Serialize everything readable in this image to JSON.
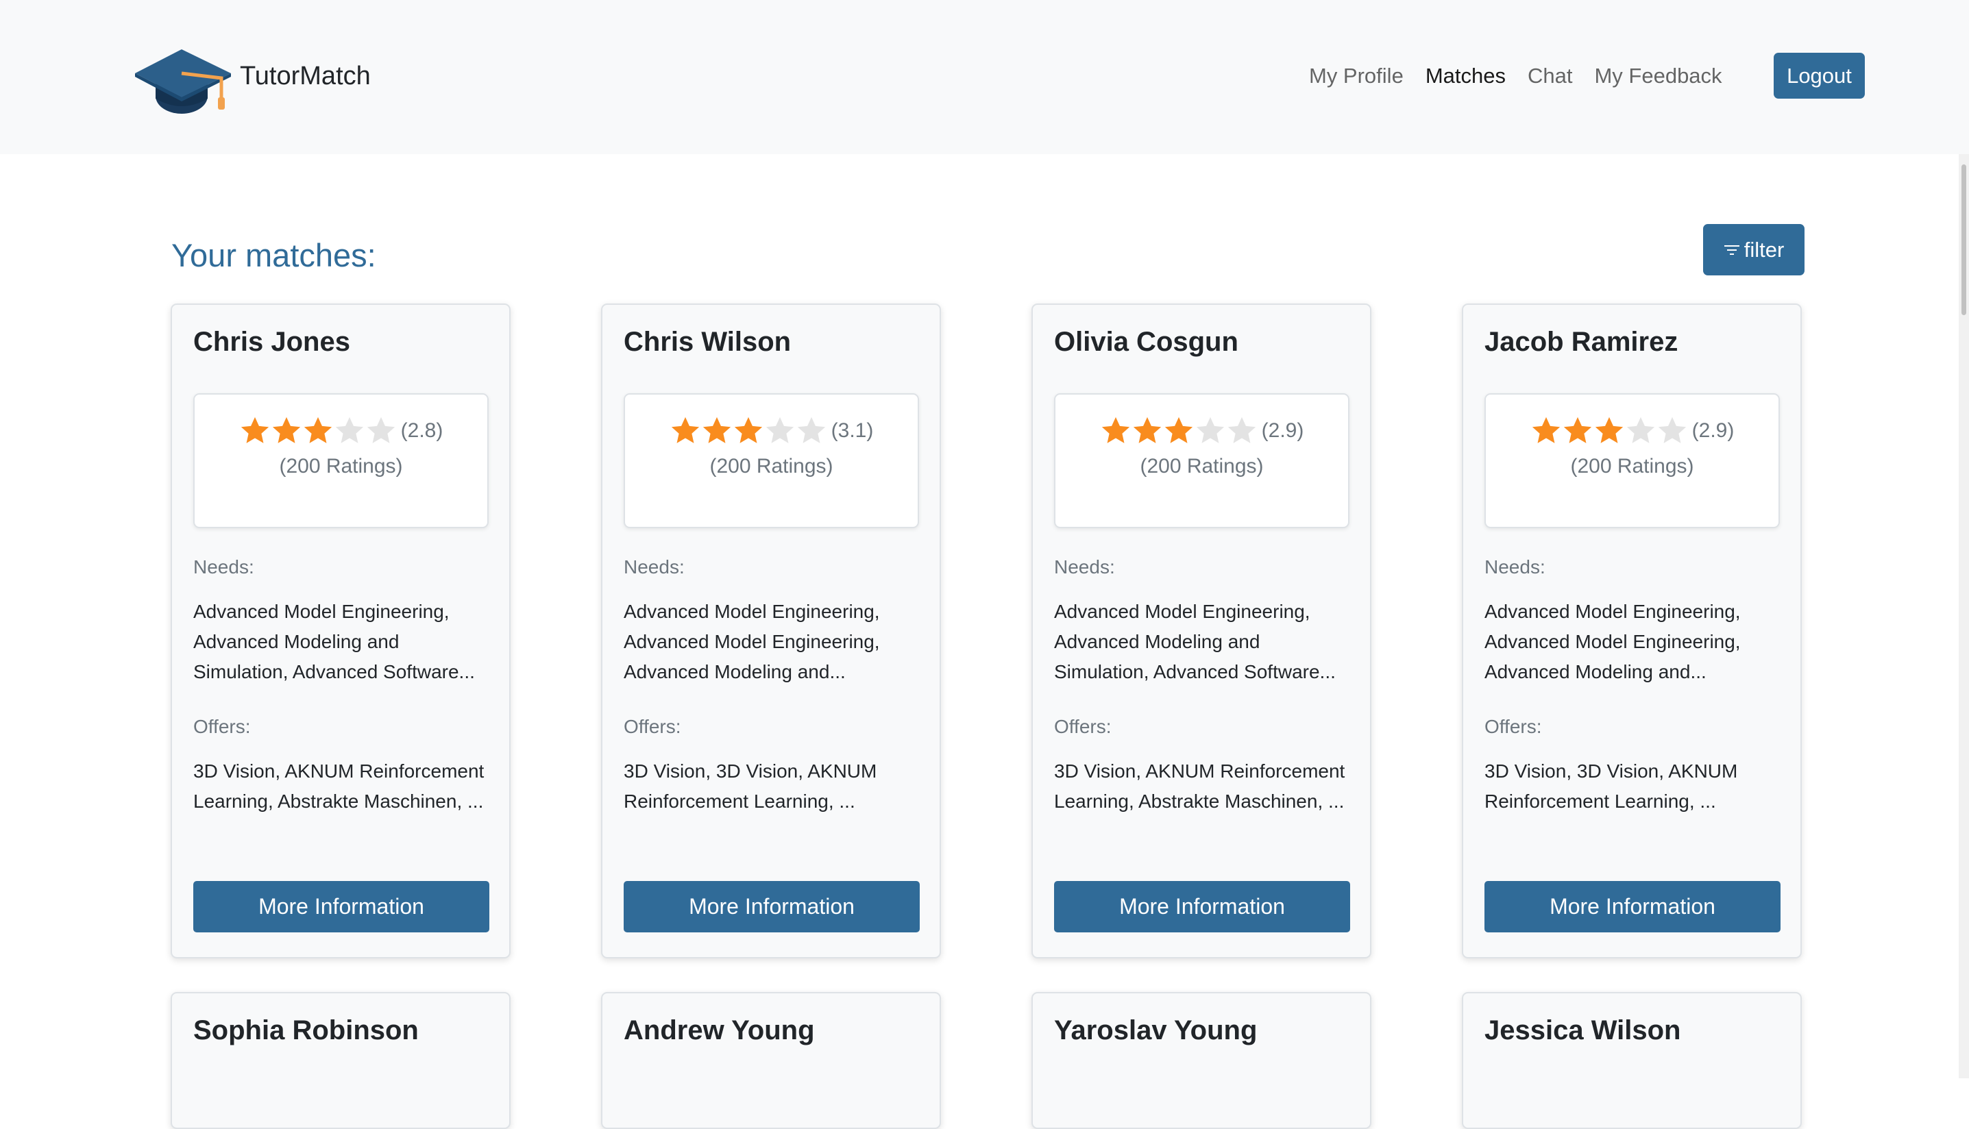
{
  "brand": {
    "name": "TutorMatch",
    "logo_icon": "graduation-cap-icon"
  },
  "nav": {
    "links": [
      {
        "label": "My Profile",
        "active": false
      },
      {
        "label": "Matches",
        "active": true
      },
      {
        "label": "Chat",
        "active": false
      },
      {
        "label": "My Feedback",
        "active": false
      }
    ],
    "logout_label": "Logout"
  },
  "page": {
    "title": "Your matches:",
    "filter_label": "filter",
    "filter_icon": "filter-lines-icon"
  },
  "colors": {
    "primary": "#306b98",
    "star_filled": "#f98c1e",
    "star_empty": "#e3e3e3",
    "navbar_bg": "#f8f9fa"
  },
  "cards": [
    {
      "name": "Chris Jones",
      "rating": 2.8,
      "rating_text": "(2.8)",
      "ratings_count": "(200 Ratings)",
      "needs_label": "Needs:",
      "needs": "Advanced Model Engineering, Advanced Modeling and Simulation, Advanced Software...",
      "offers_label": "Offers:",
      "offers": "3D Vision, AKNUM Reinforcement Learning, Abstrakte Maschinen, ...",
      "button": "More Information"
    },
    {
      "name": "Chris Wilson",
      "rating": 3.1,
      "rating_text": "(3.1)",
      "ratings_count": "(200 Ratings)",
      "needs_label": "Needs:",
      "needs": "Advanced Model Engineering, Advanced Model Engineering, Advanced Modeling and...",
      "offers_label": "Offers:",
      "offers": "3D Vision, 3D Vision, AKNUM Reinforcement Learning, ...",
      "button": "More Information"
    },
    {
      "name": "Olivia Cosgun",
      "rating": 2.9,
      "rating_text": "(2.9)",
      "ratings_count": "(200 Ratings)",
      "needs_label": "Needs:",
      "needs": "Advanced Model Engineering, Advanced Modeling and Simulation, Advanced Software...",
      "offers_label": "Offers:",
      "offers": "3D Vision, AKNUM Reinforcement Learning, Abstrakte Maschinen, ...",
      "button": "More Information"
    },
    {
      "name": "Jacob Ramirez",
      "rating": 2.9,
      "rating_text": "(2.9)",
      "ratings_count": "(200 Ratings)",
      "needs_label": "Needs:",
      "needs": "Advanced Model Engineering, Advanced Model Engineering, Advanced Modeling and...",
      "offers_label": "Offers:",
      "offers": "3D Vision, 3D Vision, AKNUM Reinforcement Learning, ...",
      "button": "More Information"
    },
    {
      "name": "Sophia Robinson"
    },
    {
      "name": "Andrew Young"
    },
    {
      "name": "Yaroslav Young"
    },
    {
      "name": "Jessica Wilson"
    }
  ]
}
